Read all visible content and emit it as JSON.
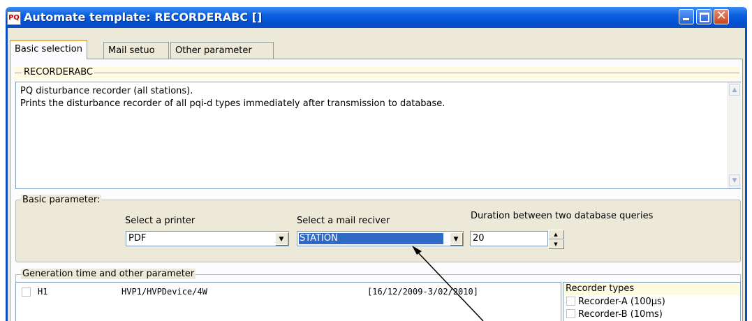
{
  "window": {
    "title": "Automate template: RECORDERABC []",
    "icon_text": "PQ",
    "controls": [
      "minimize",
      "maximize",
      "close"
    ]
  },
  "tabs": [
    {
      "label": "Basic selection",
      "active": true
    },
    {
      "label": "Mail setuo",
      "active": false
    },
    {
      "label": "Other parameter",
      "active": false
    }
  ],
  "description": {
    "group_label": "RECORDERABC",
    "line1": "PQ disturbance recorder (all stations).",
    "line2": "Prints the disturbance recorder of all pqi-d types immediately after transmission to database."
  },
  "basic_parameter": {
    "group_label": "Basic parameter:",
    "printer": {
      "label": "Select a printer",
      "value": "PDF"
    },
    "mail_receiver": {
      "label": "Select a mail reciver",
      "value": "STATION"
    },
    "duration": {
      "label": "Duration between two database queries",
      "value": "20"
    }
  },
  "generation": {
    "group_label": "Generation time and other parameter",
    "rows": [
      {
        "name": "H1",
        "device": "HVP1/HVPDevice/4W",
        "range": "[16/12/2009-3/02/2010]",
        "checked": false
      }
    ],
    "recorder_types": {
      "title": "Recorder types",
      "items": [
        "Recorder-A (100µs)",
        "Recorder-B (10ms)"
      ]
    }
  },
  "colors": {
    "titlebar": "#0a5fe0",
    "window_bg": "#ece9d8",
    "selection": "#316ac5",
    "group_header_bg": "#fffbe1"
  },
  "icons": [
    "app-pq-icon",
    "minimize-icon",
    "maximize-icon",
    "close-icon",
    "dropdown-arrow-icon",
    "spin-up-icon",
    "spin-down-icon",
    "annotation-arrow"
  ]
}
